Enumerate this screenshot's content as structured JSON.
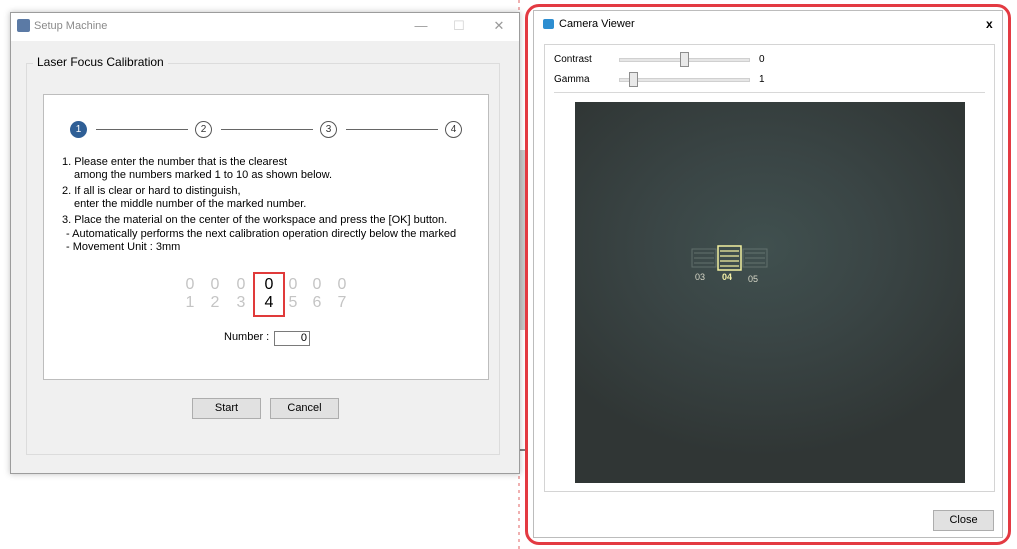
{
  "setup_window": {
    "title": "Setup Machine",
    "minimize_glyph": "—",
    "maximize_glyph": "☐",
    "close_glyph": "✕",
    "group_title": "Laser Focus Calibration",
    "steps": [
      "1",
      "2",
      "3",
      "4"
    ],
    "active_step": 1,
    "instructions": [
      "1. Please enter the number that is the clearest",
      "among the numbers marked 1 to 10 as shown below.",
      "2. If all is clear or hard to distinguish,",
      "enter the middle number of the marked number.",
      "3. Place the material on the center of the workspace and press the [OK] button.",
      "- Automatically performs the next calibration operation directly below the marked",
      "- Movement Unit : 3mm"
    ],
    "digit_columns": [
      {
        "top": "0",
        "bottom": "1"
      },
      {
        "top": "0",
        "bottom": "2"
      },
      {
        "top": "0",
        "bottom": "3"
      },
      {
        "top": "0",
        "bottom": "4"
      },
      {
        "top": "0",
        "bottom": "5"
      },
      {
        "top": "0",
        "bottom": "6"
      },
      {
        "top": "0",
        "bottom": "7"
      }
    ],
    "selected_column": 3,
    "number_label": "Number :",
    "number_value": "0",
    "start_label": "Start",
    "cancel_label": "Cancel"
  },
  "camera_viewer": {
    "title": "Camera Viewer",
    "close_glyph": "x",
    "contrast_label": "Contrast",
    "contrast_value": "0",
    "contrast_fraction": 0.5,
    "gamma_label": "Gamma",
    "gamma_value": "1",
    "gamma_fraction": 0.08,
    "image_labels": [
      "03",
      "04",
      "05"
    ],
    "close_button_label": "Close"
  },
  "colors": {
    "highlight_red": "#e33a42",
    "active_step": "#2f5f96",
    "selection_box": "#e03a3a"
  },
  "icons": [
    "app-icon",
    "camera-icon",
    "minimize-icon",
    "maximize-icon",
    "close-icon"
  ]
}
